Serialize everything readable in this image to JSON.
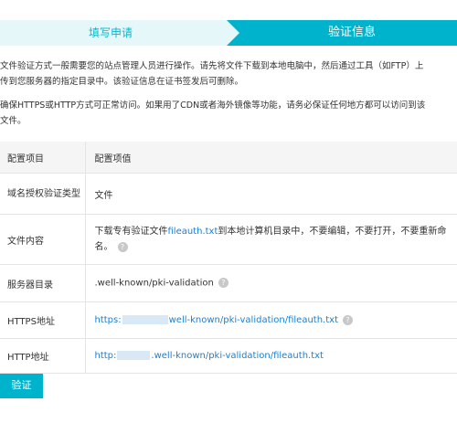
{
  "steps": {
    "step1": "填写申请",
    "step2": "验证信息"
  },
  "notice": {
    "line1": "文件验证方式一般需要您的站点管理人员进行操作。请先将文件下载到本地电脑中，然后通过工具（如FTP）上",
    "line2": "传到您服务器的指定目录中。该验证信息在证书签发后可删除。",
    "line3": "确保HTTPS或HTTP方式可正常访问。如果用了CDN或者海外镜像等功能，请务必保证任何地方都可以访问到该",
    "line4": "文件。"
  },
  "table": {
    "headers": [
      "配置项目",
      "配置项值"
    ],
    "rows": {
      "type": {
        "label": "域名授权验证类型",
        "value": "文件"
      },
      "content": {
        "label": "文件内容",
        "value_prefix": "下载专有验证文件",
        "filename": "fileauth.txt",
        "value_suffix_1": "到本地计算机目录中，不要编辑，不要打开，不要重新命",
        "value_suffix_2": "名。"
      },
      "dir": {
        "label": "服务器目录",
        "value": ".well-known/pki-validation"
      },
      "https": {
        "label": "HTTPS地址",
        "prefix": "https:",
        "suffix": "well-known/pki-validation/fileauth.txt"
      },
      "http": {
        "label": "HTTP地址",
        "prefix": "http:",
        "suffix": ".well-known/pki-validation/fileauth.txt"
      }
    }
  },
  "help_glyph": "?",
  "verify_button": "验证",
  "colors": {
    "accent": "#00b3cc",
    "step_inactive_bg": "#e6f7fa",
    "link": "#1a7fd4"
  }
}
